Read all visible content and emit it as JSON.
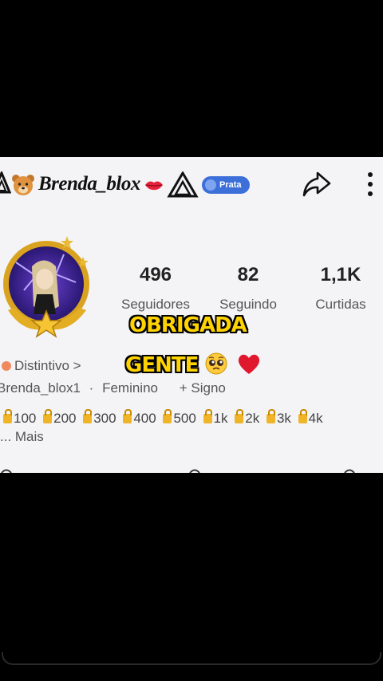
{
  "profile": {
    "username_display": "Brenda_blox",
    "badge_label": "Prata",
    "distintivo_label": "Distintivo >",
    "handle": "Brenda_blox1",
    "separator": "·",
    "gender": "Feminino",
    "sign_label": "+ Signo"
  },
  "stats": [
    {
      "value": "496",
      "label": "Seguidores"
    },
    {
      "value": "82",
      "label": "Seguindo"
    },
    {
      "value": "1,1K",
      "label": "Curtidas"
    }
  ],
  "overlay": {
    "line1": "OBRIGADA",
    "line2": "GENTE"
  },
  "milestones": [
    "100",
    "200",
    "300",
    "400",
    "500",
    "1k",
    "2k",
    "3k",
    "4k"
  ],
  "more_label": "... Mais",
  "icons": {
    "left": "triangle-logo-icon",
    "bear": "bear-emoji-icon",
    "lips": "lips-emoji-icon",
    "badge": "rank-badge-icon",
    "share": "share-icon",
    "more": "more-vertical-icon",
    "face": "pleading-face-emoji",
    "heart": "red-heart-emoji"
  },
  "colors": {
    "overlay_text": "#ffd300",
    "badge_blue": "#3d6fd9",
    "card_bg": "#f4f3f6"
  }
}
